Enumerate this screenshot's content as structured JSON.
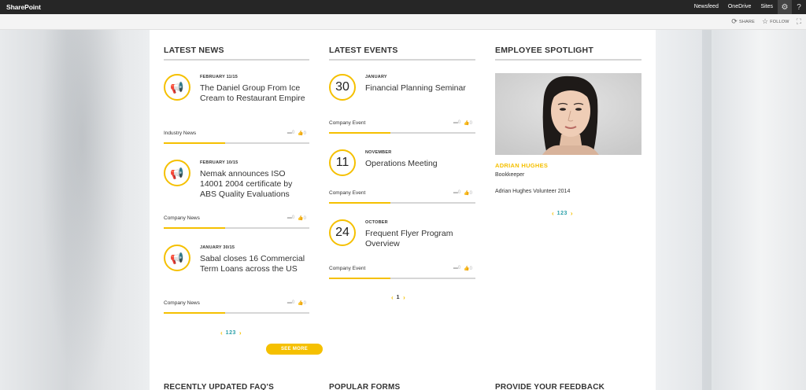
{
  "suitebar": {
    "brand": "SharePoint",
    "links": [
      "Newsfeed",
      "OneDrive",
      "Sites"
    ],
    "help": "?"
  },
  "ribbon": {
    "share": "SHARE",
    "follow": "FOLLOW"
  },
  "news": {
    "title": "LATEST NEWS",
    "items": [
      {
        "date": "FEBRUARY 11/15",
        "title": "The Daniel Group From Ice Cream to Restaurant Empire",
        "category": "Industry News",
        "comments": "0",
        "likes": "0"
      },
      {
        "date": "FEBRUARY 10/15",
        "title": "Nemak announces ISO 14001 2004 certificate by ABS Quality Evaluations",
        "category": "Company News",
        "comments": "0",
        "likes": "0"
      },
      {
        "date": "JANUARY 30/15",
        "title": "Sabal closes 16 Commercial Term Loans across the US",
        "category": "Company News",
        "comments": "0",
        "likes": "0"
      }
    ],
    "pager": "123",
    "see_more": "SEE MORE"
  },
  "events": {
    "title": "LATEST EVENTS",
    "items": [
      {
        "day": "30",
        "month": "JANUARY",
        "title": "Financial Planning Seminar",
        "category": "Company Event",
        "comments": "0",
        "likes": "0"
      },
      {
        "day": "11",
        "month": "NOVEMBER",
        "title": "Operations Meeting",
        "category": "Company Event",
        "comments": "0",
        "likes": "0"
      },
      {
        "day": "24",
        "month": "OCTOBER",
        "title": "Frequent Flyer Program Overview",
        "category": "Company Event",
        "comments": "0",
        "likes": "0"
      }
    ],
    "pager": "1"
  },
  "spotlight": {
    "title": "EMPLOYEE SPOTLIGHT",
    "name": "ADRIAN HUGHES",
    "role": "Bookkeeper",
    "description": "Adrian Hughes Volunteer 2014",
    "pager": "123"
  },
  "bottom": {
    "faqs": "RECENTLY UPDATED FAQ'S",
    "forms": "POPULAR FORMS",
    "feedback": "PROVIDE YOUR FEEDBACK"
  },
  "colors": {
    "accent": "#f5c000",
    "teal": "#2aa0a8",
    "suitebar": "#262626"
  }
}
